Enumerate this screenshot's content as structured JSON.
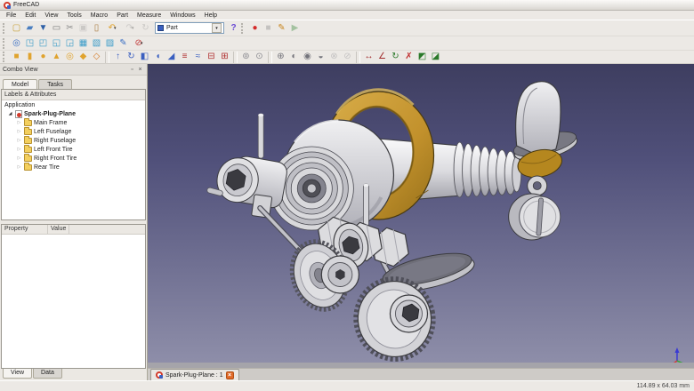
{
  "window": {
    "title": "FreeCAD"
  },
  "icons": {
    "dropdown_arrow": "▾",
    "close": "×",
    "float": "▫",
    "expanded_arrow": "◢",
    "collapsed_arrow": "▷"
  },
  "menu": {
    "items": [
      "File",
      "Edit",
      "View",
      "Tools",
      "Macro",
      "Part",
      "Measure",
      "Windows",
      "Help"
    ]
  },
  "toolbars": {
    "file": [
      {
        "name": "new-file-button",
        "glyph": "▢",
        "fg": "#c9a23a"
      },
      {
        "name": "open-file-button",
        "glyph": "▰",
        "fg": "#4a7ec0"
      },
      {
        "name": "save-file-button",
        "glyph": "▼",
        "fg": "#2d5fa6"
      },
      {
        "name": "print-button",
        "glyph": "▭",
        "fg": "#7a7a7a"
      },
      {
        "name": "cut-button",
        "glyph": "✂",
        "fg": "#8a8a8a"
      },
      {
        "name": "copy-button",
        "glyph": "▣",
        "fg": "#9a9a9a",
        "grayed": true
      },
      {
        "name": "paste-button",
        "glyph": "▯",
        "fg": "#a87b3f"
      },
      {
        "name": "undo-button",
        "glyph": "↶",
        "fg": "#e0a32e",
        "dropdown": true
      },
      {
        "name": "redo-button",
        "glyph": "↷",
        "fg": "#9a9a9a",
        "grayed": true,
        "dropdown": true
      },
      {
        "name": "refresh-button",
        "glyph": "↻",
        "fg": "#9a9a9a",
        "grayed": true
      }
    ],
    "workbench_selector": {
      "value": "Part"
    },
    "whats_this": {
      "name": "whats-this-button",
      "glyph": "?",
      "fg": "#6a4ad4"
    },
    "macro": [
      {
        "name": "macro-record-button",
        "glyph": "●",
        "fg": "#d42a2a"
      },
      {
        "name": "macro-stop-button",
        "glyph": "■",
        "fg": "#8a8a8a",
        "grayed": true
      },
      {
        "name": "macro-edit-button",
        "glyph": "✎",
        "fg": "#c8861f"
      },
      {
        "name": "macro-play-button",
        "glyph": "▶",
        "fg": "#3a8a3a",
        "grayed": true
      }
    ],
    "view": [
      {
        "name": "fit-all-button",
        "glyph": "◎",
        "fg": "#3a6fc4"
      },
      {
        "name": "view-axonometric-button",
        "glyph": "◳",
        "fg": "#3d9dc9"
      },
      {
        "name": "view-front-button",
        "glyph": "◰",
        "fg": "#3d9dc9"
      },
      {
        "name": "view-top-button",
        "glyph": "◱",
        "fg": "#3d9dc9"
      },
      {
        "name": "view-right-button",
        "glyph": "◲",
        "fg": "#3d9dc9"
      },
      {
        "name": "view-rear-button",
        "glyph": "▦",
        "fg": "#3d9dc9"
      },
      {
        "name": "view-bottom-button",
        "glyph": "▧",
        "fg": "#3d9dc9"
      },
      {
        "name": "view-left-button",
        "glyph": "▨",
        "fg": "#3d9dc9"
      },
      {
        "name": "measure-distance-button",
        "glyph": "✎",
        "fg": "#3a6fc4"
      },
      {
        "name": "draw-style-button",
        "glyph": "⊘",
        "fg": "#c23a3a",
        "dropdown": true
      }
    ],
    "part": [
      {
        "name": "part-box-button",
        "glyph": "■",
        "fg": "#e0a32e"
      },
      {
        "name": "part-cylinder-button",
        "glyph": "▮",
        "fg": "#e0a32e"
      },
      {
        "name": "part-sphere-button",
        "glyph": "●",
        "fg": "#e0a32e"
      },
      {
        "name": "part-cone-button",
        "glyph": "▲",
        "fg": "#e0a32e"
      },
      {
        "name": "part-torus-button",
        "glyph": "◎",
        "fg": "#e0a32e"
      },
      {
        "name": "create-primitives-button",
        "glyph": "◆",
        "fg": "#e0a32e"
      },
      {
        "name": "shape-builder-button",
        "glyph": "◇",
        "fg": "#d4761f"
      },
      {
        "name": "separator",
        "sep": true,
        "inter": "false"
      },
      {
        "name": "extrude-button",
        "glyph": "↑",
        "fg": "#3a5fc0"
      },
      {
        "name": "revolve-button",
        "glyph": "↻",
        "fg": "#3a5fc0"
      },
      {
        "name": "mirror-button",
        "glyph": "◧",
        "fg": "#3a5fc0"
      },
      {
        "name": "fillet-button",
        "glyph": "◖",
        "fg": "#3a5fc0"
      },
      {
        "name": "chamfer-button",
        "glyph": "◢",
        "fg": "#3a5fc0"
      },
      {
        "name": "loft-button",
        "glyph": "≡",
        "fg": "#b03030"
      },
      {
        "name": "sweep-button",
        "glyph": "≈",
        "fg": "#3a5fc0"
      },
      {
        "name": "section-button",
        "glyph": "⊟",
        "fg": "#b03030"
      },
      {
        "name": "cross-sections-button",
        "glyph": "⊞",
        "fg": "#b03030"
      },
      {
        "name": "separator",
        "sep": true,
        "inter": "false"
      },
      {
        "name": "offset-button",
        "glyph": "⊚",
        "fg": "#8a8a90"
      },
      {
        "name": "thickness-button",
        "glyph": "⊙",
        "fg": "#8a8a90"
      },
      {
        "name": "separator",
        "sep": true,
        "inter": "false"
      },
      {
        "name": "boolean-button",
        "glyph": "⊕",
        "fg": "#74747c"
      },
      {
        "name": "boolean-cut-button",
        "glyph": "◐",
        "fg": "#74747c"
      },
      {
        "name": "boolean-union-button",
        "glyph": "◉",
        "fg": "#74747c"
      },
      {
        "name": "boolean-common-button",
        "glyph": "◒",
        "fg": "#74747c"
      },
      {
        "name": "connect-objects-button",
        "glyph": "⊗",
        "fg": "#8a8a90",
        "grayed": true
      },
      {
        "name": "split-objects-button",
        "glyph": "⊘",
        "fg": "#8a8a90",
        "grayed": true
      },
      {
        "name": "separator",
        "sep": true,
        "inter": "false"
      },
      {
        "name": "measure-linear-button",
        "glyph": "↔",
        "fg": "#a02a2a"
      },
      {
        "name": "measure-angular-button",
        "glyph": "∠",
        "fg": "#a02a2a"
      },
      {
        "name": "measure-refresh-button",
        "glyph": "↻",
        "fg": "#2a7a2a"
      },
      {
        "name": "measure-clear-all-button",
        "glyph": "✗",
        "fg": "#c03030"
      },
      {
        "name": "measure-toggle-all-button",
        "glyph": "◩",
        "fg": "#2a7a2a"
      },
      {
        "name": "measure-toggle-3d-button",
        "glyph": "◪",
        "fg": "#2a7a2a"
      }
    ]
  },
  "combo_view": {
    "title": "Combo View",
    "tabs": {
      "model": "Model",
      "tasks": "Tasks"
    },
    "tree_header": "Labels & Attributes",
    "root_label": "Application",
    "document_label": "Spark-Plug-Plane",
    "children": [
      "Main Frame",
      "Left Fuselage",
      "Right Fuselage",
      "Left Front Tire",
      "Right Front Tire",
      "Rear Tire"
    ],
    "property_columns": [
      "Property",
      "Value"
    ],
    "bottom_tabs": {
      "view": "View",
      "data": "Data"
    }
  },
  "viewport": {
    "document_tab": "Spark-Plug-Plane : 1",
    "model_name": "Spark-Plug-Plane",
    "colors": {
      "background_top": "#3e3e60",
      "background_bottom": "#8e8ea9",
      "brass": "#c2912c",
      "steel": "#d2d2d6",
      "outline": "#3c3c40"
    }
  },
  "status_bar": {
    "size_indicator": "114.89 x 64.03 mm"
  }
}
